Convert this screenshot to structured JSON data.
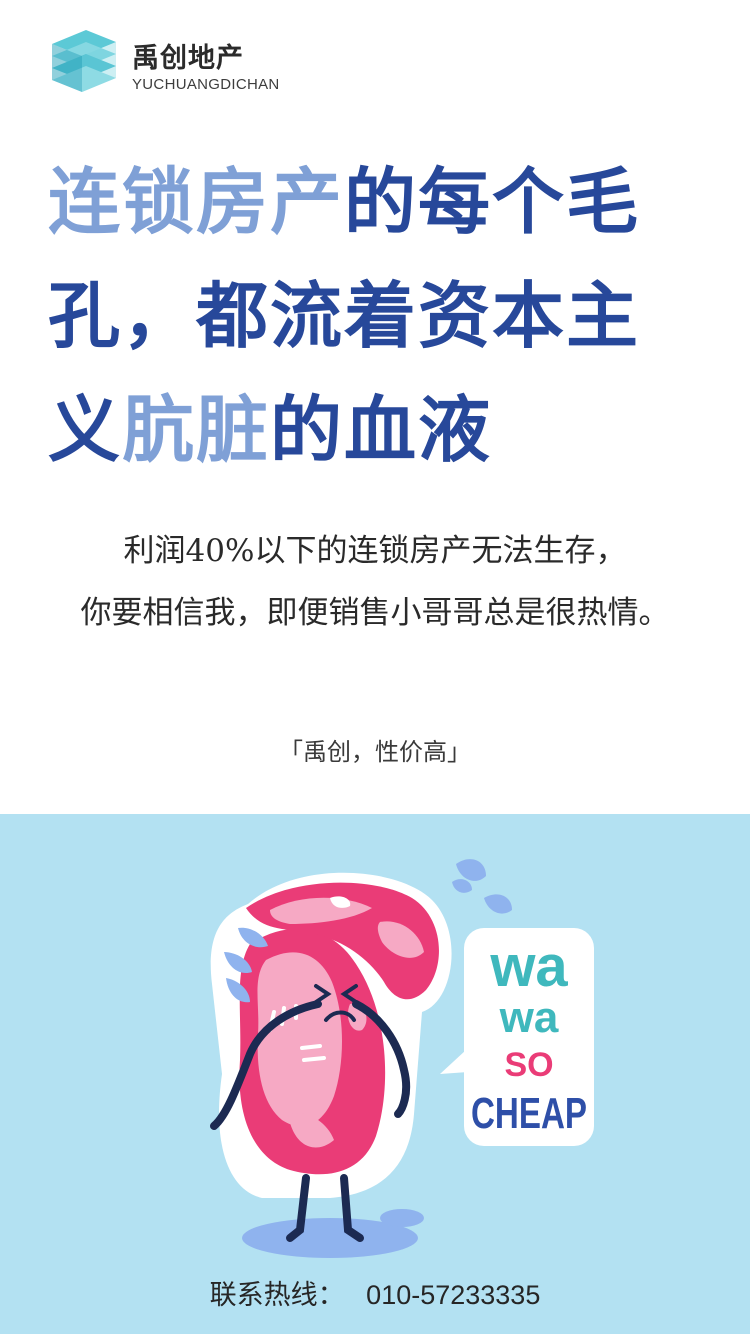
{
  "brand": {
    "name": "禹创地产",
    "name_en": "YUCHUANGDICHAN"
  },
  "headline": {
    "lines": [
      [
        {
          "text": "连锁房产",
          "style": "light"
        },
        {
          "text": "的每个毛",
          "style": "dark"
        }
      ],
      [
        {
          "text": "孔，都流着资本主",
          "style": "dark"
        }
      ],
      [
        {
          "text": "义",
          "style": "dark"
        },
        {
          "text": "肮脏",
          "style": "light"
        },
        {
          "text": "的血液",
          "style": "dark"
        }
      ]
    ],
    "color_dark": "#27489a",
    "color_light": "#7fa0d6"
  },
  "body": {
    "line1": "利润40%以下的连锁房产无法生存，",
    "line2": "你要相信我，即便销售小哥哥总是很热情。"
  },
  "tagline": "「禹创，性价高」",
  "illustration": {
    "speech": {
      "line1": "wa",
      "line2": "wa",
      "line3": "SO",
      "line4": "CHEAP"
    }
  },
  "contact": {
    "label": "联系热线：",
    "phone": "010-57233335"
  },
  "colors": {
    "panel_bg": "#b3e1f2",
    "accent_teal": "#3fb8bd",
    "accent_pink": "#ea3c77",
    "cheap_blue": "#2e4fa8"
  },
  "icons": [
    "building-logo-icon",
    "crying-meat-character",
    "tear-drops-icon"
  ]
}
